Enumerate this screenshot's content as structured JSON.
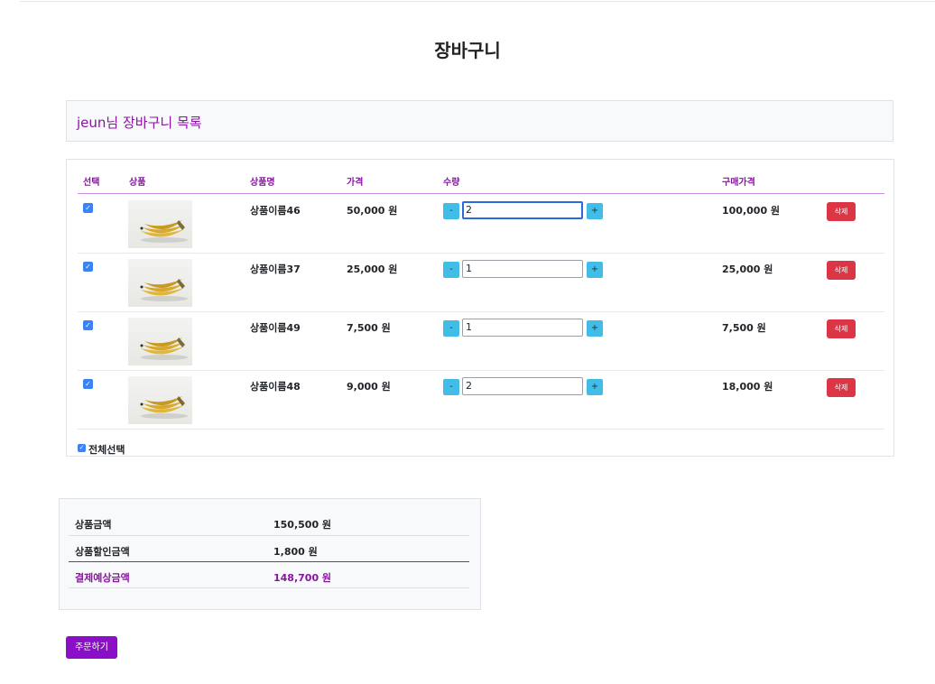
{
  "page_title": "장바구니",
  "list_header": "jeun님 장바구니 목록",
  "columns": {
    "select": "선택",
    "product": "상품",
    "product_name": "상품명",
    "price": "가격",
    "quantity": "수량",
    "purchase_price": "구매가격"
  },
  "items": [
    {
      "name": "상품이름46",
      "price": "50,000 원",
      "qty": "2",
      "total": "100,000 원",
      "minus": "-",
      "plus": "+",
      "delete": "삭제",
      "checked": true
    },
    {
      "name": "상품이름37",
      "price": "25,000 원",
      "qty": "1",
      "total": "25,000 원",
      "minus": "-",
      "plus": "+",
      "delete": "삭제",
      "checked": true
    },
    {
      "name": "상품이름49",
      "price": "7,500 원",
      "qty": "1",
      "total": "7,500 원",
      "minus": "-",
      "plus": "+",
      "delete": "삭제",
      "checked": true
    },
    {
      "name": "상품이름48",
      "price": "9,000 원",
      "qty": "2",
      "total": "18,000 원",
      "minus": "-",
      "plus": "+",
      "delete": "삭제",
      "checked": true
    }
  ],
  "select_all": {
    "label": "전체선택",
    "checked": true
  },
  "summary": {
    "product_amount_label": "상품금액",
    "product_amount": "150,500 원",
    "discount_label": "상품할인금액",
    "discount": "1,800 원",
    "expected_label": "결제예상금액",
    "expected": "148,700 원"
  },
  "order_button": "주문하기",
  "icons": {
    "checkbox": "checkmark-icon",
    "product_image": "banana-image"
  },
  "colors": {
    "accent": "#8a13a3",
    "qty_button": "#42bde8",
    "delete_button": "#dc3545",
    "order_button": "#8a0fc6",
    "checkbox": "#3b82f6"
  }
}
